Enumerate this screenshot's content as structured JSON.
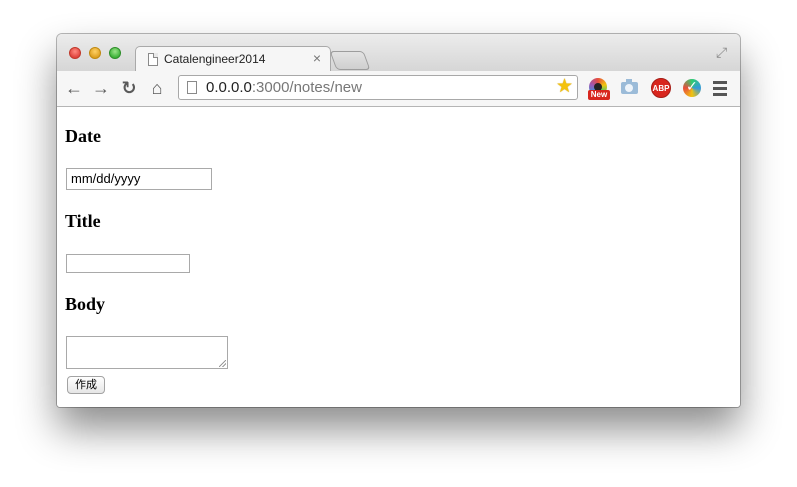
{
  "tab": {
    "title": "Catalengineer2014",
    "close_glyph": "×"
  },
  "toolbar": {
    "back_glyph": "←",
    "forward_glyph": "→",
    "reload_glyph": "↻",
    "home_glyph": "⌂",
    "url_host": "0.0.0.0",
    "url_path": ":3000/notes/new",
    "extensions": [
      {
        "icon": "ring-extension-icon",
        "badge": "New"
      },
      {
        "icon": "camera-extension-icon"
      },
      {
        "icon": "adblock-plus-icon",
        "label": "ABP"
      },
      {
        "icon": "check-extension-icon"
      }
    ],
    "menu_icon": "hamburger-menu-icon"
  },
  "form": {
    "date_heading": "Date",
    "date_placeholder": "mm/dd/yyyy",
    "title_heading": "Title",
    "title_value": "",
    "body_heading": "Body",
    "body_value": "",
    "submit_label": "作成"
  },
  "colors": {
    "star": "#f4c20d",
    "badge_red": "#d8261e"
  }
}
